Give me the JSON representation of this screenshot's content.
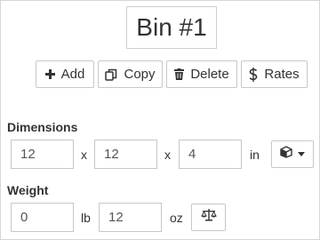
{
  "title": "Bin #1",
  "toolbar": {
    "add_label": "Add",
    "copy_label": "Copy",
    "delete_label": "Delete",
    "rates_label": "Rates",
    "icons": [
      "plus-icon",
      "copy-icon",
      "trash-icon",
      "dollar-icon"
    ]
  },
  "dimensions": {
    "label": "Dimensions",
    "length": "12",
    "width": "12",
    "height": "4",
    "separator": "x",
    "unit": "in",
    "icon": "box-icon"
  },
  "weight": {
    "label": "Weight",
    "pounds": "0",
    "pound_unit": "lb",
    "ounces": "12",
    "ounce_unit": "oz",
    "icon": "scale-icon"
  }
}
